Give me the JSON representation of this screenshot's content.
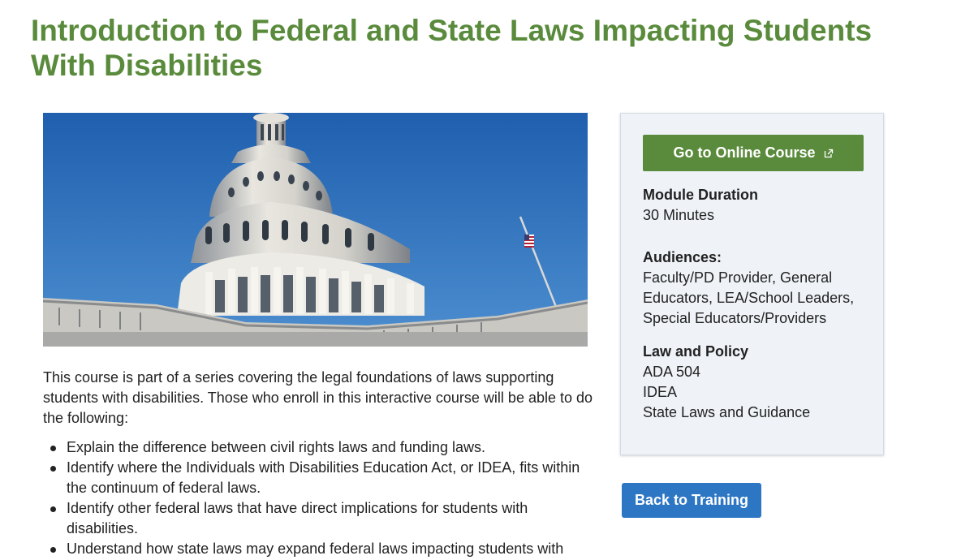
{
  "page": {
    "title": "Introduction to Federal and State Laws Impacting Students With Disabilities"
  },
  "hero_image": {
    "subject": "capitol-dome-photo"
  },
  "description": "This course is part of a series covering the legal foundations of laws supporting students with disabilities. Those who enroll in this interactive course will be able to do the following:",
  "objectives": [
    "Explain the difference between civil rights laws and funding laws.",
    "Identify where the Individuals with Disabilities Education Act, or IDEA, fits within the continuum of federal laws.",
    "Identify other federal laws that have direct implications for students with disabilities.",
    "Understand how state laws may expand federal laws impacting students with"
  ],
  "sidebar": {
    "course_button_label": "Go to Online Course",
    "course_button_icon": "external-link-icon",
    "duration_label": "Module Duration",
    "duration_value": "30 Minutes",
    "audiences_label": "Audiences:",
    "audiences_value": "Faculty/PD Provider, General Educators, LEA/School Leaders, Special Educators/Providers",
    "law_label": "Law and Policy",
    "law_items": [
      "ADA 504",
      "IDEA",
      "State Laws and Guidance"
    ]
  },
  "back_button_label": "Back to Training",
  "colors": {
    "title_green": "#5a8b3c",
    "button_green": "#5a8b3c",
    "button_blue": "#2c76c4",
    "card_bg": "#eff3f7",
    "sky_blue": "#2f6bb5"
  }
}
